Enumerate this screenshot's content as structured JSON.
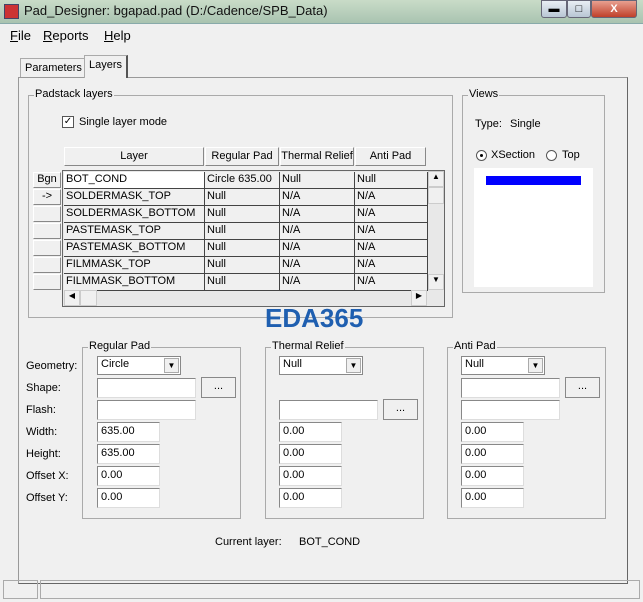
{
  "window": {
    "title": "Pad_Designer: bgapad.pad (D:/Cadence/SPB_Data)",
    "minimize": "▬",
    "maximize": "□",
    "close": "X"
  },
  "menu": [
    {
      "label": "File",
      "key": "F",
      "rest": "ile"
    },
    {
      "label": "Reports",
      "key": "R",
      "rest": "eports"
    },
    {
      "label": "Help",
      "key": "H",
      "rest": "elp"
    }
  ],
  "tabs": [
    {
      "label": "Parameters",
      "active": false
    },
    {
      "label": "Layers",
      "active": true
    }
  ],
  "padstack": {
    "group_label": "Padstack layers",
    "single_layer_mode_label": "Single layer mode",
    "single_layer_mode": true,
    "columns": [
      "Layer",
      "Regular Pad",
      "Thermal Relief",
      "Anti Pad"
    ],
    "row_buttons": [
      "Bgn",
      "->",
      "",
      "",
      "",
      "",
      ""
    ],
    "rows": [
      [
        "BOT_COND",
        "Circle 635.00",
        "Null",
        "Null"
      ],
      [
        "SOLDERMASK_TOP",
        "Null",
        "N/A",
        "N/A"
      ],
      [
        "SOLDERMASK_BOTTOM",
        "Null",
        "N/A",
        "N/A"
      ],
      [
        "PASTEMASK_TOP",
        "Null",
        "N/A",
        "N/A"
      ],
      [
        "PASTEMASK_BOTTOM",
        "Null",
        "N/A",
        "N/A"
      ],
      [
        "FILMMASK_TOP",
        "Null",
        "N/A",
        "N/A"
      ],
      [
        "FILMMASK_BOTTOM",
        "Null",
        "N/A",
        "N/A"
      ]
    ]
  },
  "views": {
    "group_label": "Views",
    "type_label": "Type:",
    "type_value": "Single",
    "radio_xsection": "XSection",
    "radio_top": "Top",
    "selected": "XSection",
    "layer_color": "#0000ff"
  },
  "field_labels": [
    "Geometry:",
    "Shape:",
    "Flash:",
    "Width:",
    "Height:",
    "Offset X:",
    "Offset Y:"
  ],
  "regular_pad": {
    "label": "Regular Pad",
    "geometry": "Circle",
    "shape": "",
    "flash": "",
    "width": "635.00",
    "height": "635.00",
    "offset_x": "0.00",
    "offset_y": "0.00",
    "browse": "..."
  },
  "thermal_relief": {
    "label": "Thermal Relief",
    "geometry": "Null",
    "flash": "",
    "width": "0.00",
    "height": "0.00",
    "offset_x": "0.00",
    "offset_y": "0.00",
    "browse": "..."
  },
  "anti_pad": {
    "label": "Anti Pad",
    "geometry": "Null",
    "shape": "",
    "flash": "",
    "width": "0.00",
    "height": "0.00",
    "offset_x": "0.00",
    "offset_y": "0.00",
    "browse": "..."
  },
  "current_layer": {
    "label": "Current layer:",
    "value": "BOT_COND"
  },
  "watermark": "EDA365"
}
